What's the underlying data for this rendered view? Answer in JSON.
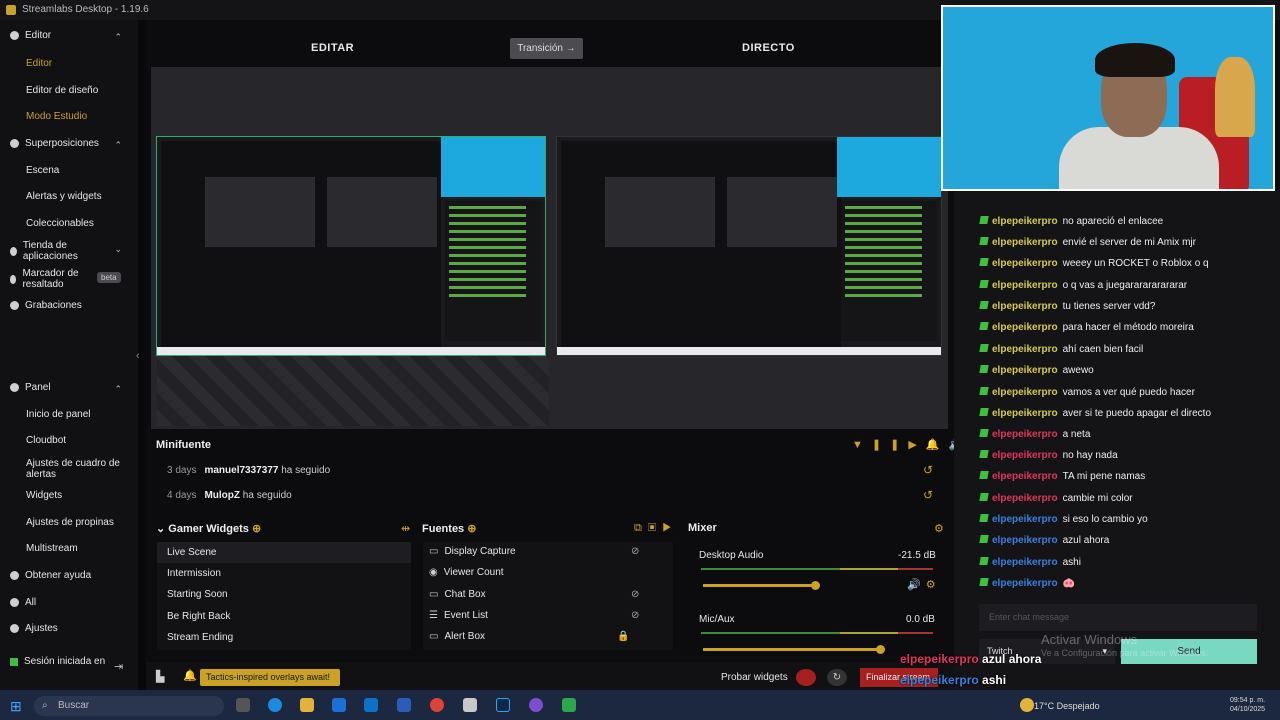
{
  "window": {
    "title": "Streamlabs Desktop - 1.19.6"
  },
  "sidebar": {
    "editor_header": "Editor",
    "editor_items": [
      "Editor",
      "Editor de diseño",
      "Modo Estudio"
    ],
    "superposiciones_header": "Superposiciones",
    "superposiciones_items": [
      "Escena",
      "Alertas y widgets",
      "Coleccionables"
    ],
    "tienda": "Tienda de aplicaciones",
    "marcador": "Marcador de resaltado",
    "marcador_badge": "beta",
    "grabaciones": "Grabaciones",
    "panel_header": "Panel",
    "panel_items": [
      "Inicio de panel",
      "Cloudbot",
      "Ajustes de cuadro de alertas",
      "Widgets",
      "Ajustes de propinas",
      "Multistream"
    ],
    "obtener_ayuda": "Obtener ayuda",
    "all": "All",
    "ajustes": "Ajustes",
    "sesion": "Sesión iniciada en"
  },
  "header": {
    "editar": "EDITAR",
    "transicion": "Transición →",
    "directo": "DIRECTO"
  },
  "minifuente": {
    "title": "Minifuente",
    "events": [
      {
        "time": "3 days",
        "user": "manuel7337377",
        "action": "ha seguido"
      },
      {
        "time": "4 days",
        "user": "MulopZ",
        "action": "ha seguido"
      }
    ]
  },
  "gamer_widgets": {
    "title": "Gamer Widgets",
    "items": [
      "Live Scene",
      "Intermission",
      "Starting Soon",
      "Be Right Back",
      "Stream Ending"
    ]
  },
  "fuentes": {
    "title": "Fuentes",
    "items": [
      "Display Capture",
      "Viewer Count",
      "Chat Box",
      "Event List",
      "Alert Box"
    ]
  },
  "mixer": {
    "title": "Mixer",
    "channels": [
      {
        "name": "Desktop Audio",
        "level": "-21.5 dB",
        "volume": 0.6
      },
      {
        "name": "Mic/Aux",
        "level": "0.0 dB",
        "volume": 0.95
      }
    ]
  },
  "bottom": {
    "promo": "Tactics-inspired overlays await!",
    "probar": "Probar widgets",
    "finalizar": "Finalizar stream"
  },
  "chat": {
    "messages": [
      {
        "user": "elpepeikerpro",
        "text": "no apareció el enlacee",
        "color": "#d6c94a"
      },
      {
        "user": "elpepeikerpro",
        "text": "envié el server de mi Amix mjr",
        "color": "#d6c94a"
      },
      {
        "user": "elpepeikerpro",
        "text": "weeey un ROCKET o Roblox o q",
        "color": "#d6c94a"
      },
      {
        "user": "elpepeikerpro",
        "text": "o q vas a juegararararararar",
        "color": "#d6c94a"
      },
      {
        "user": "elpepeikerpro",
        "text": "tu tienes server vdd?",
        "color": "#d6c94a"
      },
      {
        "user": "elpepeikerpro",
        "text": "para hacer el método moreira",
        "color": "#d6c94a"
      },
      {
        "user": "elpepeikerpro",
        "text": "ahí caen bien facil",
        "color": "#d6c94a"
      },
      {
        "user": "elpepeikerpro",
        "text": "awewo",
        "color": "#d6c94a"
      },
      {
        "user": "elpepeikerpro",
        "text": "vamos a ver qué puedo hacer",
        "color": "#d6c94a"
      },
      {
        "user": "elpepeikerpro",
        "text": "aver si te puedo apagar el directo",
        "color": "#d6c94a"
      },
      {
        "user": "elpepeikerpro",
        "text": "a neta",
        "color": "#e0365a"
      },
      {
        "user": "elpepeikerpro",
        "text": "no hay nada",
        "color": "#e0365a"
      },
      {
        "user": "elpepeikerpro",
        "text": "TA mi pene namas",
        "color": "#e0365a"
      },
      {
        "user": "elpepeikerpro",
        "text": "cambie mi color",
        "color": "#e0365a"
      },
      {
        "user": "elpepeikerpro",
        "text": "si eso lo cambio yo",
        "color": "#3b7fe0"
      },
      {
        "user": "elpepeikerpro",
        "text": "azul ahora",
        "color": "#3b7fe0"
      },
      {
        "user": "elpepeikerpro",
        "text": "ashi",
        "color": "#3b7fe0"
      },
      {
        "user": "elpepeikerpro",
        "text": "🐽",
        "color": "#3b7fe0"
      }
    ],
    "input_placeholder": "Enter chat message",
    "platform": "Twitch",
    "send": "Send"
  },
  "watermark": {
    "line1": "Activar Windows",
    "line2": "Ve a Configuración para activar Windows."
  },
  "overlay_chat": [
    {
      "user": "elpepeikerpro",
      "text": "azul ahora",
      "color": "#e0365a"
    },
    {
      "user": "elpepeikerpro",
      "text": "ashi",
      "color": "#3b7fe0"
    }
  ],
  "taskbar": {
    "search": "Buscar",
    "weather": "17°C  Despejado",
    "time": "09:54 p. m.",
    "date": "04/10/2025"
  }
}
